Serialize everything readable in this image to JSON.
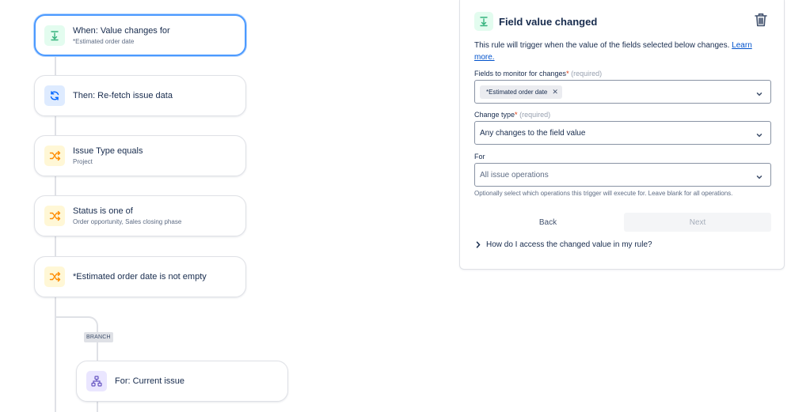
{
  "flow": {
    "nodes": [
      {
        "title": "When: Value changes for",
        "sub": "*Estimated order date",
        "icon": "trigger-icon",
        "selected": true
      },
      {
        "title": "Then: Re-fetch issue data",
        "sub": "",
        "icon": "refresh-icon"
      },
      {
        "title": "Issue Type equals",
        "sub": "Project",
        "icon": "shuffle-icon"
      },
      {
        "title": "Status is one of",
        "sub": "Order opportunity, Sales closing phase",
        "icon": "shuffle-icon"
      },
      {
        "title": "*Estimated order date is not empty",
        "sub": "",
        "icon": "shuffle-icon"
      },
      {
        "title": "For: Current issue",
        "sub": "",
        "icon": "hierarchy-icon"
      }
    ],
    "branch_tag": "BRANCH"
  },
  "panel": {
    "title": "Field value changed",
    "description": "This rule will trigger when the value of the fields selected below changes.",
    "learn_more": "Learn more.",
    "fields_label": "Fields to monitor for changes",
    "required_text": "(required)",
    "fields_chip": "*Estimated order date",
    "change_type_label": "Change type",
    "change_type_value": "Any changes to the field value",
    "for_label": "For",
    "for_placeholder": "All issue operations",
    "for_hint": "Optionally select which operations this trigger will execute for. Leave blank for all operations.",
    "back_label": "Back",
    "next_label": "Next",
    "expander_label": "How do I access the changed value in my rule?"
  },
  "colors": {
    "trigger": "#36b37e",
    "action": "#0065ff",
    "condition": "#ff8b00",
    "branch": "#6554c0",
    "selected_border": "#4c9aff",
    "link": "#0052cc"
  }
}
